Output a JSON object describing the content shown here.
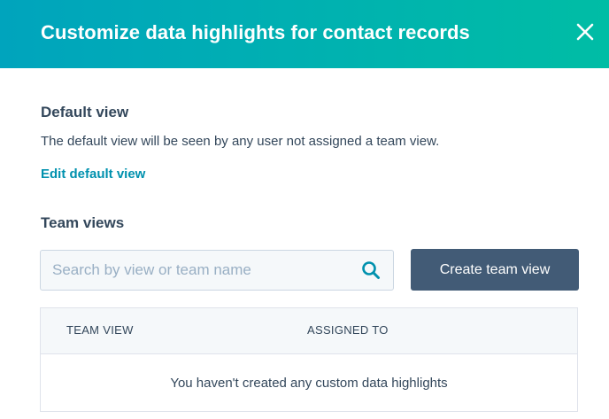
{
  "header": {
    "title": "Customize data highlights for contact records",
    "close_icon": "close-icon"
  },
  "default_view": {
    "title": "Default view",
    "description": "The default view will be seen by any user not assigned a team view.",
    "edit_link": "Edit default view"
  },
  "team_views": {
    "title": "Team views",
    "search": {
      "placeholder": "Search by view or team name",
      "value": "",
      "icon": "search-icon"
    },
    "create_button": "Create team view",
    "table": {
      "columns": [
        "TEAM VIEW",
        "ASSIGNED TO"
      ],
      "rows": [],
      "empty_message": "You haven't created any custom data highlights"
    }
  },
  "colors": {
    "header_gradient_start": "#00a4bd",
    "header_gradient_end": "#00bda5",
    "link": "#0091ae",
    "primary_button": "#425b76",
    "text": "#33475b"
  }
}
